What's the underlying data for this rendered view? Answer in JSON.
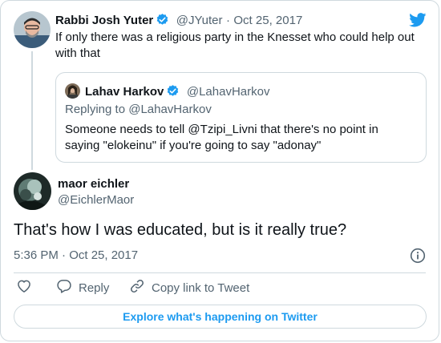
{
  "colors": {
    "accent": "#1d9bf0",
    "text": "#0f1419",
    "muted": "#536471",
    "border": "#cfd9de"
  },
  "brand_icon": "twitter-bird-icon",
  "parent_tweet": {
    "author_name": "Rabbi Josh Yuter",
    "handle": "@JYuter",
    "separator": "·",
    "date": "Oct 25, 2017",
    "text": "If only there was a religious party in the Knesset who could help out with that",
    "verified_icon": "verified-badge-icon"
  },
  "quoted_tweet": {
    "author_name": "Lahav Harkov",
    "handle": "@LahavHarkov",
    "replying_to": "Replying to @LahavHarkov",
    "text": "Someone needs to tell @Tzipi_Livni that there's no point in saying \"elokeinu\" if you're going to say \"adonay\"",
    "verified_icon": "verified-badge-icon"
  },
  "main_tweet": {
    "author_name": "maor eichler",
    "handle": "@EichlerMaor",
    "text": "That's how I was educated, but is it really true?",
    "timestamp": "5:36 PM · Oct 25, 2017",
    "info_icon": "info-icon"
  },
  "actions": {
    "like_icon": "heart-icon",
    "reply_label": "Reply",
    "reply_icon": "reply-bubble-icon",
    "copy_label": "Copy link to Tweet",
    "copy_icon": "link-icon"
  },
  "explore_label": "Explore what's happening on Twitter"
}
